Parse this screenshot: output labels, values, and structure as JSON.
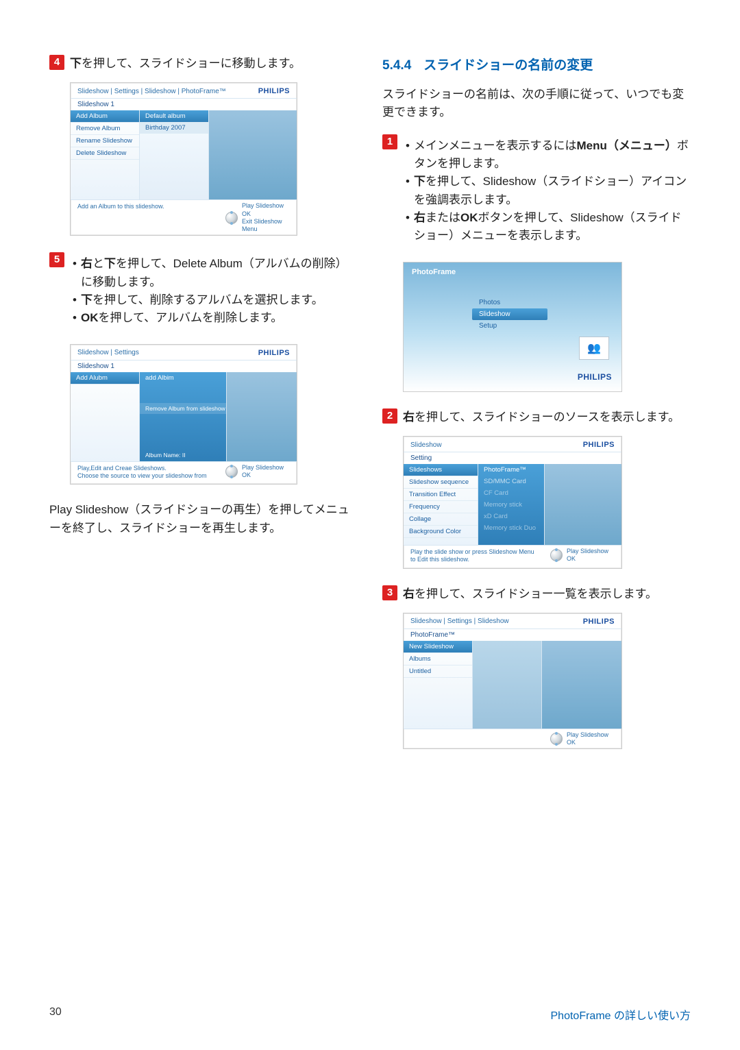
{
  "left": {
    "step4": {
      "num": "4",
      "text_pre": "下",
      "text_post": "を押して、スライドショーに移動します。"
    },
    "screen1": {
      "crumb": "Slideshow | Settings | Slideshow | PhotoFrame™",
      "brand": "PHILIPS",
      "row1": "Slideshow 1",
      "colA": [
        "Add Album",
        "Remove Album",
        "Rename Slideshow",
        "Delete Slideshow"
      ],
      "colA_sel": 0,
      "colB": [
        "Default album",
        "Birthday 2007"
      ],
      "colB_head_sel": 0,
      "foot_l": "Add an Album to this slideshow.",
      "foot_r1": "Play Slideshow",
      "foot_r2": "OK",
      "foot_r3": "Exit Slideshow Menu"
    },
    "step5": {
      "num": "5",
      "bullet1_pre1": "右",
      "bullet1_mid": "と",
      "bullet1_pre2": "下",
      "bullet1_rest": "を押して、Delete Album（アルバムの削除）に移動します。",
      "bullet2_pre": "下",
      "bullet2_rest": "を押して、削除するアルバムを選択します。",
      "bullet3_pre": "OK",
      "bullet3_rest": "を押して、アルバムを削除します。"
    },
    "screen2": {
      "crumb": "Slideshow | Settings",
      "brand": "PHILIPS",
      "row1": "Slideshow 1",
      "colA": [
        "Add Alubm"
      ],
      "colB_top": "add Albim",
      "colB_bar": "Remove Album from slideshow",
      "colB_tag": "Album Name: II",
      "foot_l1": "Play,Edit and Creae Slideshows.",
      "foot_l2": "Choose the source to view your slideshow from",
      "foot_r1": "Play Slideshow",
      "foot_r2": "OK"
    },
    "play_para_b": "Play Slideshow（スライドショーの再生）",
    "play_para_rest": "を押してメニューを終了し、スライドショーを再生します。"
  },
  "right": {
    "heading_num": "5.4.4",
    "heading": "スライドショーの名前の変更",
    "intro": "スライドショーの名前は、次の手順に従って、いつでも変更できます。",
    "step1": {
      "num": "1",
      "b1a": "メインメニューを表示するには",
      "b1b": "Menu（メニュー）",
      "b1c": "ボタンを押します。",
      "b2a": "下",
      "b2b": "を押して、Slideshow（スライドショー）アイコンを強調表示します。",
      "b3a": "右",
      "b3b": "または",
      "b3c": "OK",
      "b3d": "ボタンを押して、Slideshow（スライドショー）メニューを表示します。"
    },
    "pf": {
      "title": "PhotoFrame",
      "items": [
        "Photos",
        "Slideshow",
        "Setup"
      ],
      "sel": 1,
      "brand": "PHILIPS"
    },
    "step2": {
      "num": "2",
      "pre": "右",
      "rest": "を押して、スライドショーのソースを表示します。"
    },
    "screen3": {
      "crumb": "Slideshow",
      "brand": "PHILIPS",
      "row1": "Setting",
      "colA": [
        "Slideshows",
        "Slideshow sequence",
        "Transition Effect",
        "Frequency",
        "Collage",
        "Background Color"
      ],
      "colA_sel": 0,
      "colB": [
        "PhotoFrame™",
        "SD/MMC Card",
        "CF Card",
        "Memory stick",
        "xD Card",
        "Memory stick Duo"
      ],
      "foot_l1": "Play the slide show or press Slideshow Menu",
      "foot_l2": "to Edit this slideshow.",
      "foot_r1": "Play Slideshow",
      "foot_r2": "OK"
    },
    "step3": {
      "num": "3",
      "pre": "右",
      "rest": "を押して、スライドショー一覧を表示します。"
    },
    "screen4": {
      "crumb": "Slideshow | Settings | Slideshow",
      "brand": "PHILIPS",
      "row1": "PhotoFrame™",
      "colA": [
        "New Slideshow",
        "Albums",
        "Untitled"
      ],
      "colA_sel": 0,
      "foot_r1": "Play Slideshow",
      "foot_r2": "OK"
    }
  },
  "footer": {
    "page": "30",
    "title": "PhotoFrame の詳しい使い方"
  }
}
